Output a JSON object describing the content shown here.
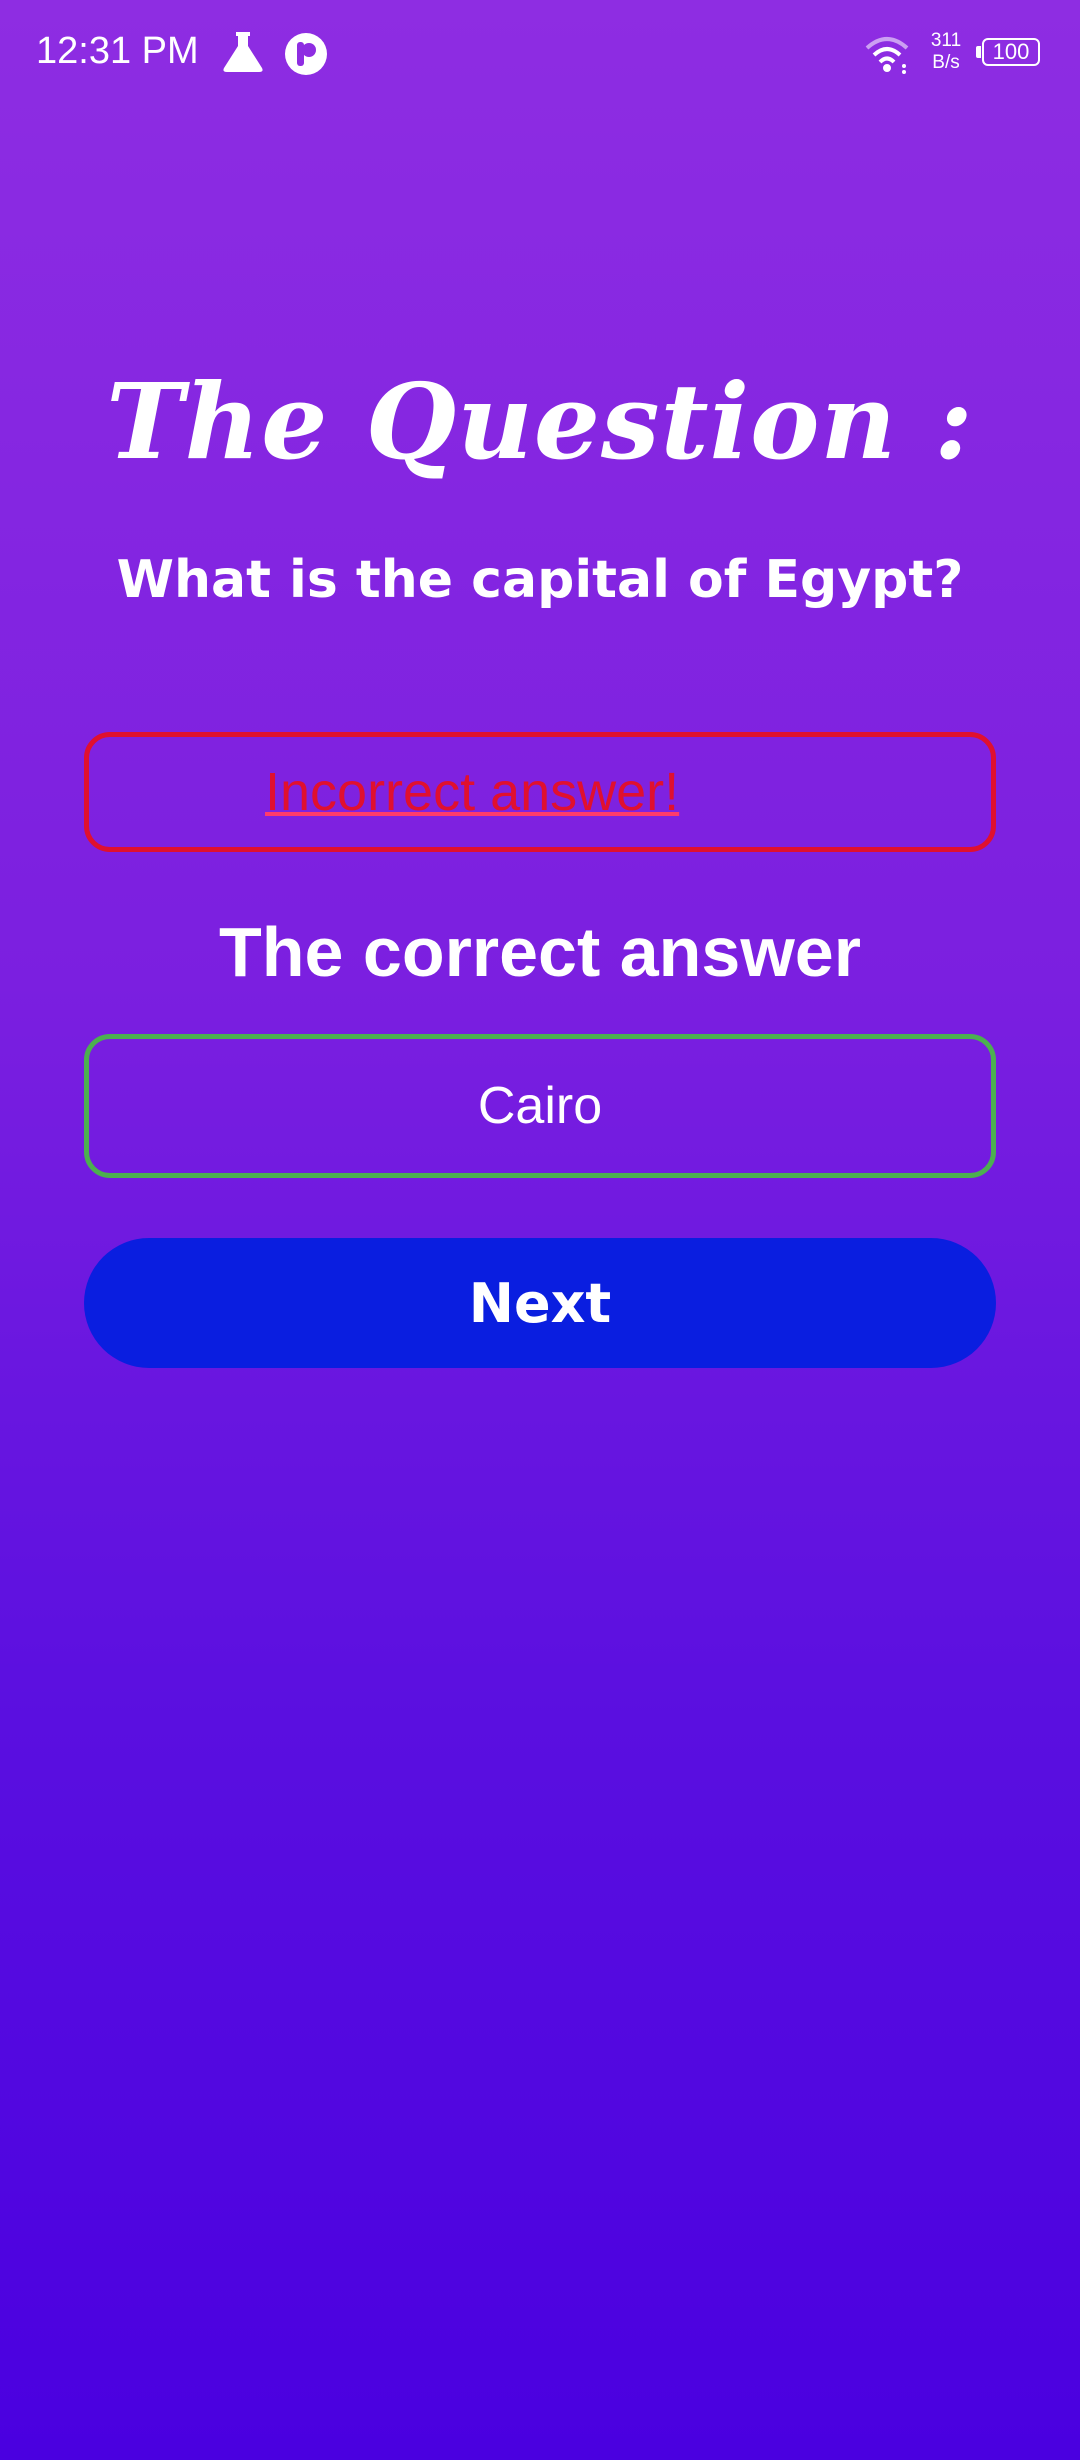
{
  "status_bar": {
    "time": "12:31 PM",
    "net_speed_value": "311",
    "net_speed_unit": "B/s",
    "battery": "100",
    "icons": [
      "flask-icon",
      "app-badge-icon",
      "wifi-icon",
      "battery-icon"
    ]
  },
  "quiz": {
    "heading": "The Question :",
    "question": "What is the capital of Egypt?",
    "result_message": "Incorrect answer!",
    "correct_label": "The correct answer",
    "correct_answer": "Cairo",
    "next_label": "Next"
  },
  "colors": {
    "background_top": "#8e2de2",
    "background_bottom": "#4a00e0",
    "incorrect": "#e0102f",
    "correct": "#4caf50",
    "button": "#0a1ee0"
  }
}
